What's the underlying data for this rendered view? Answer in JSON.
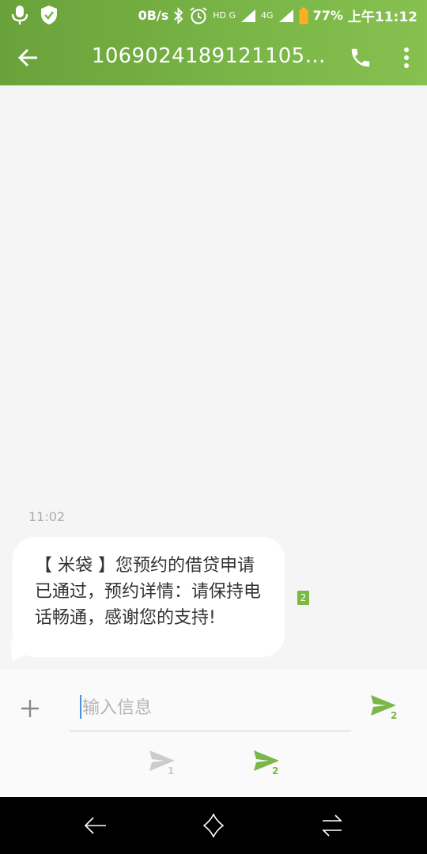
{
  "status_bar": {
    "speed": "0B/s",
    "net1": "HD G",
    "net2": "4G",
    "battery": "77%",
    "time": "上午11:12"
  },
  "app_bar": {
    "title": "10690241891211050…",
    "icons": [
      "back-arrow-icon",
      "phone-icon",
      "more-vert-icon"
    ]
  },
  "conversation": {
    "messages": [
      {
        "time": "11:02",
        "text": "【 米袋 】您预约的借贷申请已通过，预约详情：请保持电话畅通，感谢您的支持!",
        "sim": "2"
      }
    ]
  },
  "compose": {
    "placeholder": "输入信息",
    "send_main_sim": "2",
    "send_sim1": "1",
    "send_sim2": "2"
  },
  "colors": {
    "accent": "#7ab648",
    "muted": "#cccccc",
    "bubble": "#ffffff",
    "background": "#f5f5f5"
  }
}
